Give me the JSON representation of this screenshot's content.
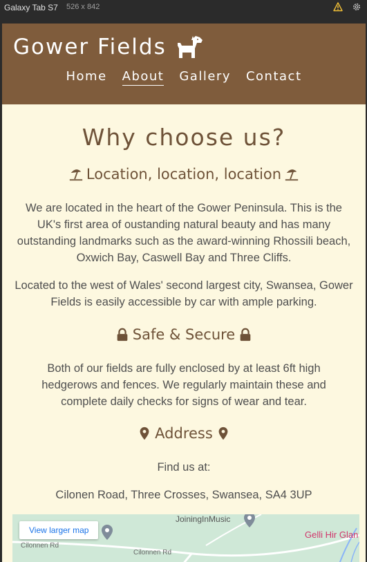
{
  "devtools": {
    "device": "Galaxy Tab S7",
    "dimensions": "526 x 842",
    "icons": [
      "warning-icon",
      "settings-gear-icon"
    ]
  },
  "header": {
    "brand": "Gower Fields",
    "brand_icon": "dog-icon",
    "nav": [
      {
        "label": "Home",
        "active": false
      },
      {
        "label": "About",
        "active": true
      },
      {
        "label": "Gallery",
        "active": false
      },
      {
        "label": "Contact",
        "active": false
      }
    ]
  },
  "main": {
    "title": "Why choose us?",
    "sections": [
      {
        "heading": "Location, location, location",
        "icon": "umbrella-beach-icon",
        "paragraphs": [
          "We are located in the heart of the Gower Peninsula. This is the UK's first area of oustanding natural beauty and has many outstanding landmarks such as the award-winning Rhossili beach, Oxwich Bay, Caswell Bay and Three Cliffs.",
          "Located to the west of Wales' second largest city, Swansea, Gower Fields is easily accessible by car with ample parking."
        ]
      },
      {
        "heading": "Safe & Secure",
        "icon": "lock-icon",
        "paragraphs": [
          "Both of our fields are fully enclosed by at least 6ft high hedgerows and fences. We regularly maintain these and complete daily checks for signs of wear and tear."
        ]
      },
      {
        "heading": "Address",
        "icon": "map-marker-icon",
        "paragraphs": [
          "Find us at:",
          "Cilonen Road, Three Crosses, Swansea, SA4 3UP"
        ]
      }
    ]
  },
  "map": {
    "view_larger": "View larger map",
    "labels": {
      "place1": "JoiningInMusic",
      "place2": "Gelli Hir Glan",
      "road1": "Cilonnen Rd",
      "road2": "Cilonnen Rd"
    }
  },
  "colors": {
    "header_bg": "#7f5c3c",
    "page_bg": "#fdf8e0",
    "heading": "#6e5238"
  }
}
